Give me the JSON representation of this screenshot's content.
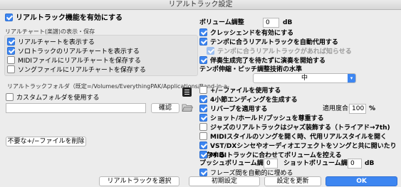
{
  "window": {
    "title": "リアルトラック設定"
  },
  "left": {
    "enable_realtracks": "リアルトラック機能を有効にする",
    "chart_group_label": "リアルチャート(楽譜)の表示・保存",
    "chart_options": [
      {
        "label": "リアルチャートを表示する",
        "checked": true
      },
      {
        "label": "ソロトラックのリアルチャートを表示する",
        "checked": true
      },
      {
        "label": "MIDIファイルにリアルチャートを保存する",
        "checked": false
      },
      {
        "label": "ソングファイルにリアルチャートを保存する",
        "checked": false
      }
    ],
    "folder_label": "リアルトラックフォルダ（既定=/Volumes/EverythingPAK/Applications/Band-in-a-",
    "custom_folder": "カスタムフォルダを使用する",
    "custom_folder_path": "",
    "confirm_button": "確認",
    "delete_button": "不要な+/−ファイルを削除"
  },
  "right": {
    "volume_label": "ボリューム調整",
    "volume_value": "0",
    "volume_unit": "dB",
    "options_a": [
      {
        "label": "クレッシェンドを有効にする",
        "checked": true,
        "disabled": false,
        "indent": false
      },
      {
        "label": "テンポに合うリアルトラックを自動代用する",
        "checked": true,
        "disabled": false,
        "indent": false
      },
      {
        "label": "テンポに合うリアルトラックがあれば知らせる",
        "checked": true,
        "disabled": true,
        "indent": true
      },
      {
        "label": "伴奏生成完了を待たずに演奏を開始する",
        "checked": true,
        "disabled": false,
        "indent": false
      }
    ],
    "tempo_quality_label": "テンポ伸縮・ピッチ調整技術の水準",
    "tempo_quality_value": "中",
    "options_b": [
      {
        "label": "+/−ファイルを使用する",
        "checked": false,
        "disabled": false
      },
      {
        "label": "4小節エンディングを生成する",
        "checked": true,
        "disabled": false
      },
      {
        "label": "リバーブを適用する",
        "checked": true,
        "disabled": false
      },
      {
        "label": "ショット/ホールド/プッシュを尊重する",
        "checked": true,
        "disabled": false
      },
      {
        "label": "ジャズのリアルトラックはジャズ装飾する（トライアド→7th)",
        "checked": false,
        "disabled": false
      },
      {
        "label": "MIDIスタイルのソングを開く時、代用リアルスタイルを開く",
        "checked": false,
        "disabled": false
      },
      {
        "label": "VST/DXシンセやオーディオエフェクトをソングと共に開いたり保存する",
        "checked": true,
        "disabled": false
      },
      {
        "label": "MIDIトラックに合わせてボリュームを控える",
        "checked": true,
        "disabled": false
      }
    ],
    "apply_degree_label": "適用度合",
    "apply_degree_value": "100",
    "apply_degree_unit": "%",
    "push_volume_label": "プッシュボリューム調整",
    "push_volume_value": "0",
    "shot_volume_label": "ショットボリューム調整",
    "shot_volume_value": "0",
    "db_unit": "dB",
    "phrase_fade": {
      "label": "フレーズ間を自動的に埋める",
      "checked": true
    }
  },
  "footer": {
    "select_button": "リアルトラックを選択",
    "defaults_button": "初期設定",
    "update_button": "設定を更新",
    "ok_button": "OK"
  },
  "colors": {
    "accent": "#3d86f1",
    "background": "#ececec"
  }
}
